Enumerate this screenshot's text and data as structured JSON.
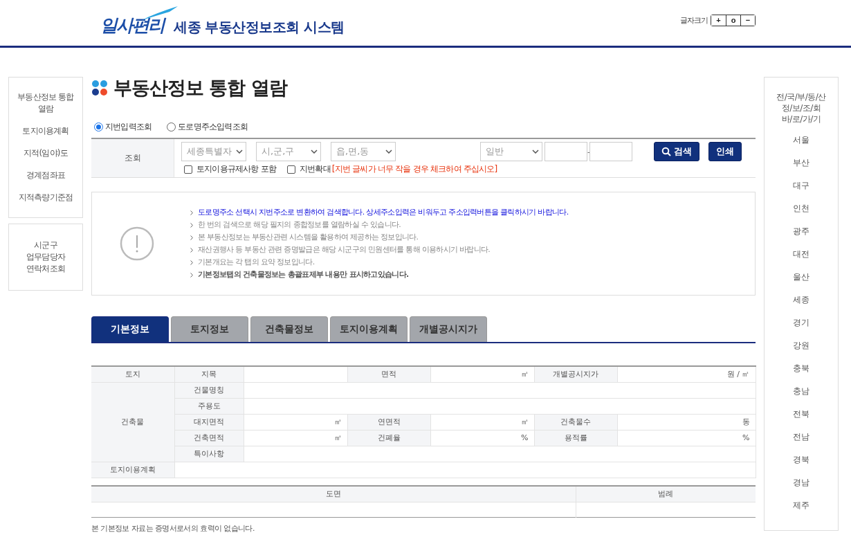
{
  "header": {
    "logo_text": "일사편리",
    "title": "세종 부동산정보조회 시스템",
    "font_size_label": "글자크기",
    "font_size_buttons": [
      "+",
      "o",
      "−"
    ]
  },
  "left_menu": {
    "items": [
      "부동산정보 통합 열람",
      "토지이용계획",
      "지적(임야)도",
      "경계점좌표",
      "지적측량기준점"
    ],
    "contact": "시군구\n업무담당자\n연락처조회"
  },
  "page_title": "부동산정보 통합 열람",
  "search_modes": [
    {
      "label": "지번입력조회",
      "selected": true
    },
    {
      "label": "도로명주소입력조회",
      "selected": false
    }
  ],
  "search": {
    "label": "조회",
    "selects": [
      "세종특별자",
      "시,군,구",
      "읍,면,동"
    ],
    "type_select": "일반",
    "separator": "-",
    "checkboxes": [
      {
        "label": "토지이용규제사항 포함",
        "checked": false
      },
      {
        "label": "지번확대",
        "checked": false
      }
    ],
    "zoom_note": "[지번 글씨가 너무 작을 경우 체크하여 주십시오]",
    "search_button": "검색",
    "print_button": "인쇄"
  },
  "notices": [
    {
      "text": "도로명주소 선택시 지번주소로 변환하여 검색합니다. 상세주소입력은 비워두고 주소입력버튼을 클릭하시기 바랍니다.",
      "kind": "highlight"
    },
    {
      "text": "한 번의 검색으로 해당 필지의 종합정보를 열람하실 수 있습니다.",
      "kind": "normal"
    },
    {
      "text": "본 부동산정보는 부동산관련 시스템을 활용하여 제공하는 정보입니다.",
      "kind": "normal"
    },
    {
      "text": "재산권행사 등 부동산 관련 증명발급은 해당 시군구의 민원센터를 통해 이용하시기 바랍니다.",
      "kind": "normal"
    },
    {
      "text": "기본개요는 각 탭의 요약 정보입니다.",
      "kind": "normal"
    },
    {
      "text": "기본정보탭의 건축물정보는 총괄표제부 내용만 표시하고있습니다.",
      "kind": "bold"
    }
  ],
  "tabs": [
    {
      "label": "기본정보",
      "selected": true
    },
    {
      "label": "토지정보",
      "selected": false
    },
    {
      "label": "건축물정보",
      "selected": false
    },
    {
      "label": "토지이용계획",
      "selected": false
    },
    {
      "label": "개별공시지가",
      "selected": false
    }
  ],
  "info_table": {
    "rows": [
      [
        {
          "kind": "head",
          "text": "토지"
        },
        {
          "kind": "head",
          "text": "지목"
        },
        {
          "kind": "value"
        },
        {
          "kind": "head",
          "text": "면적"
        },
        {
          "kind": "value",
          "text": "㎡"
        },
        {
          "kind": "head",
          "text": "개별공시지가"
        },
        {
          "kind": "value",
          "text": "원 / ㎡"
        }
      ],
      [
        {
          "kind": "head",
          "text": "건축물",
          "rowspan": 5
        },
        {
          "kind": "head",
          "text": "건물명칭"
        },
        {
          "kind": "value",
          "colspan": 5
        }
      ],
      [
        {
          "kind": "head",
          "text": "주용도"
        },
        {
          "kind": "value",
          "colspan": 5
        }
      ],
      [
        {
          "kind": "head",
          "text": "대지면적"
        },
        {
          "kind": "value",
          "text": "㎡"
        },
        {
          "kind": "head",
          "text": "연면적"
        },
        {
          "kind": "value",
          "text": "㎡"
        },
        {
          "kind": "head",
          "text": "건축물수"
        },
        {
          "kind": "value",
          "text": "동"
        }
      ],
      [
        {
          "kind": "head",
          "text": "건축면적"
        },
        {
          "kind": "value",
          "text": "㎡"
        },
        {
          "kind": "head",
          "text": "건폐율"
        },
        {
          "kind": "value",
          "text": "%"
        },
        {
          "kind": "head",
          "text": "용적률"
        },
        {
          "kind": "value",
          "text": "%"
        }
      ],
      [
        {
          "kind": "head",
          "text": "특이사항"
        },
        {
          "kind": "value",
          "colspan": 5
        }
      ],
      [
        {
          "kind": "head",
          "text": "토지이용계획"
        },
        {
          "kind": "value",
          "colspan": 6
        }
      ]
    ]
  },
  "drawing_table": {
    "columns": [
      "도면",
      "범례"
    ]
  },
  "footnote": "본 기본정보 자료는 증명서로서의 효력이 없습니다.",
  "right_menu": {
    "title": "전/국/부/동/산\n정/보/조/회\n바/로/가/기",
    "items": [
      "서울",
      "부산",
      "대구",
      "인천",
      "광주",
      "대전",
      "울산",
      "세종",
      "경기",
      "강원",
      "충북",
      "충남",
      "전북",
      "전남",
      "경북",
      "경남",
      "제주"
    ]
  }
}
